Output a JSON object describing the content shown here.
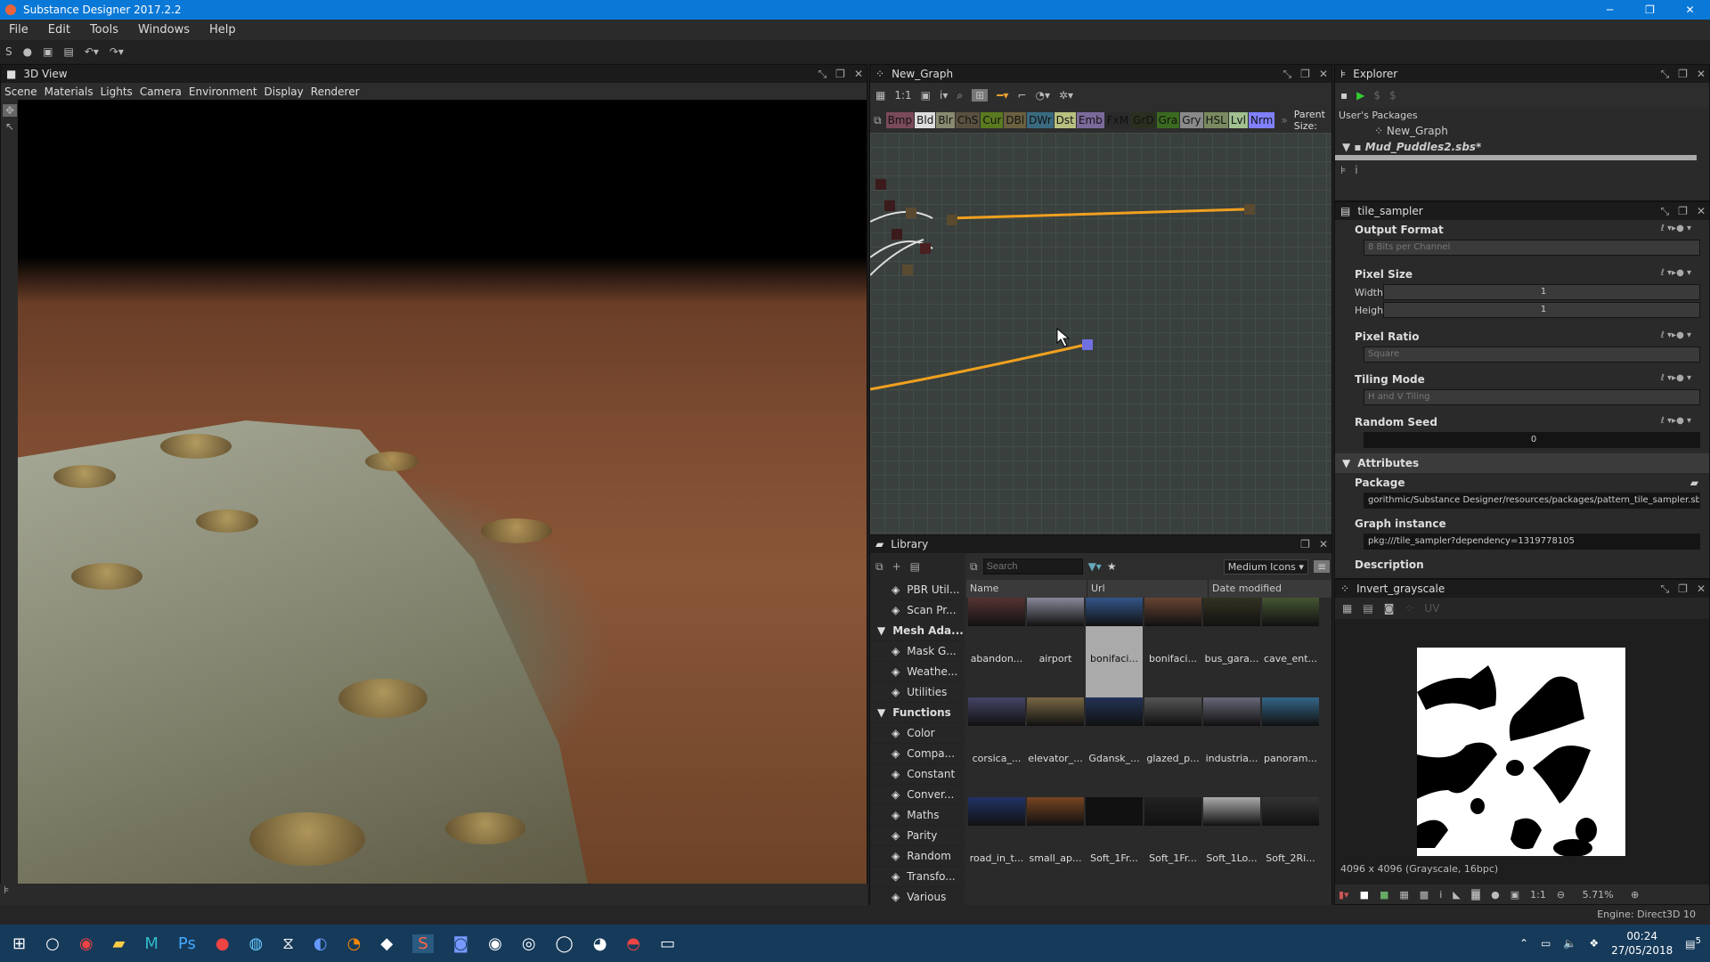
{
  "window": {
    "title": "Substance Designer 2017.2.2"
  },
  "menu": [
    "File",
    "Edit",
    "Tools",
    "Windows",
    "Help"
  ],
  "view3d": {
    "title": "3D View",
    "menu": [
      "Scene",
      "Materials",
      "Lights",
      "Camera",
      "Environment",
      "Display",
      "Renderer"
    ]
  },
  "graph": {
    "title": "New_Graph",
    "zoom_label": "1:1",
    "parent_size": "Parent Size:",
    "categories": [
      {
        "l": "Bmp",
        "c": "#7a4a5a"
      },
      {
        "l": "Bld",
        "c": "#ddd"
      },
      {
        "l": "Blr",
        "c": "#8a8a70"
      },
      {
        "l": "ChS",
        "c": "#5a5040"
      },
      {
        "l": "Cur",
        "c": "#5a7a20"
      },
      {
        "l": "DBl",
        "c": "#6a6040"
      },
      {
        "l": "DWr",
        "c": "#3a6a80"
      },
      {
        "l": "Dst",
        "c": "#b8c080"
      },
      {
        "l": "Emb",
        "c": "#7a6a9a"
      },
      {
        "l": "FxM",
        "c": "#2a2a2a"
      },
      {
        "l": "GrD",
        "c": "#2a3020"
      },
      {
        "l": "Gra",
        "c": "#3a6a20"
      },
      {
        "l": "Gry",
        "c": "#8a8a8a"
      },
      {
        "l": "HSL",
        "c": "#7a8a60"
      },
      {
        "l": "Lvl",
        "c": "#a0c090"
      },
      {
        "l": "Nrm",
        "c": "#8080ff"
      }
    ]
  },
  "explorer": {
    "title": "Explorer",
    "section": "User's Packages",
    "items": [
      "New_Graph",
      "Mud_Puddles2.sbs*"
    ]
  },
  "properties": {
    "title": "tile_sampler",
    "output_format": {
      "label": "Output Format",
      "value": "8 Bits per Channel"
    },
    "pixel_size": {
      "label": "Pixel Size",
      "width_label": "Width",
      "width": "1",
      "height_label": "Height",
      "height": "1"
    },
    "pixel_ratio": {
      "label": "Pixel Ratio",
      "value": "Square"
    },
    "tiling_mode": {
      "label": "Tiling Mode",
      "value": "H and V Tiling"
    },
    "random_seed": {
      "label": "Random Seed",
      "value": "0"
    },
    "attributes": {
      "label": "Attributes",
      "package_label": "Package",
      "package": "gorithmic/Substance Designer/resources/packages/pattern_tile_sampler.sbs",
      "graph_instance_label": "Graph instance",
      "graph_instance": "pkg:///tile_sampler?dependency=1319778105",
      "description_label": "Description"
    }
  },
  "library": {
    "title": "Library",
    "search_placeholder": "Search",
    "view_mode": "Medium Icons",
    "columns": [
      "Name",
      "Url",
      "Date modified"
    ],
    "tree": [
      {
        "l": "PBR Util...",
        "c": false
      },
      {
        "l": "Scan Pr...",
        "c": false
      },
      {
        "l": "Mesh Ada...",
        "c": true
      },
      {
        "l": "Mask G...",
        "c": false
      },
      {
        "l": "Weathe...",
        "c": false
      },
      {
        "l": "Utilities",
        "c": false
      },
      {
        "l": "Functions",
        "c": true
      },
      {
        "l": "Color",
        "c": false
      },
      {
        "l": "Compa...",
        "c": false
      },
      {
        "l": "Constant",
        "c": false
      },
      {
        "l": "Conver...",
        "c": false
      },
      {
        "l": "Maths",
        "c": false
      },
      {
        "l": "Parity",
        "c": false
      },
      {
        "l": "Random",
        "c": false
      },
      {
        "l": "Transfo...",
        "c": false
      },
      {
        "l": "Various",
        "c": false
      }
    ],
    "items": [
      "abandon...",
      "airport",
      "bonifaci...",
      "bonifaci...",
      "bus_gara...",
      "cave_ent...",
      "corsica_...",
      "elevator_...",
      "Gdansk_...",
      "glazed_p...",
      "industria...",
      "panoram...",
      "road_in_t...",
      "small_ap...",
      "Soft_1Fr...",
      "Soft_1Fr...",
      "Soft_1Lo...",
      "Soft_2Ri..."
    ],
    "selected_index": 2
  },
  "viewer2d": {
    "title": "Invert_grayscale",
    "info": "4096 x 4096 (Grayscale, 16bpc)",
    "zoom": "5.71%",
    "ratio": "1:1",
    "uv": "UV"
  },
  "status": {
    "engine": "Engine: Direct3D 10"
  },
  "taskbar": {
    "time": "00:24",
    "date": "27/05/2018",
    "notifications": "5"
  }
}
